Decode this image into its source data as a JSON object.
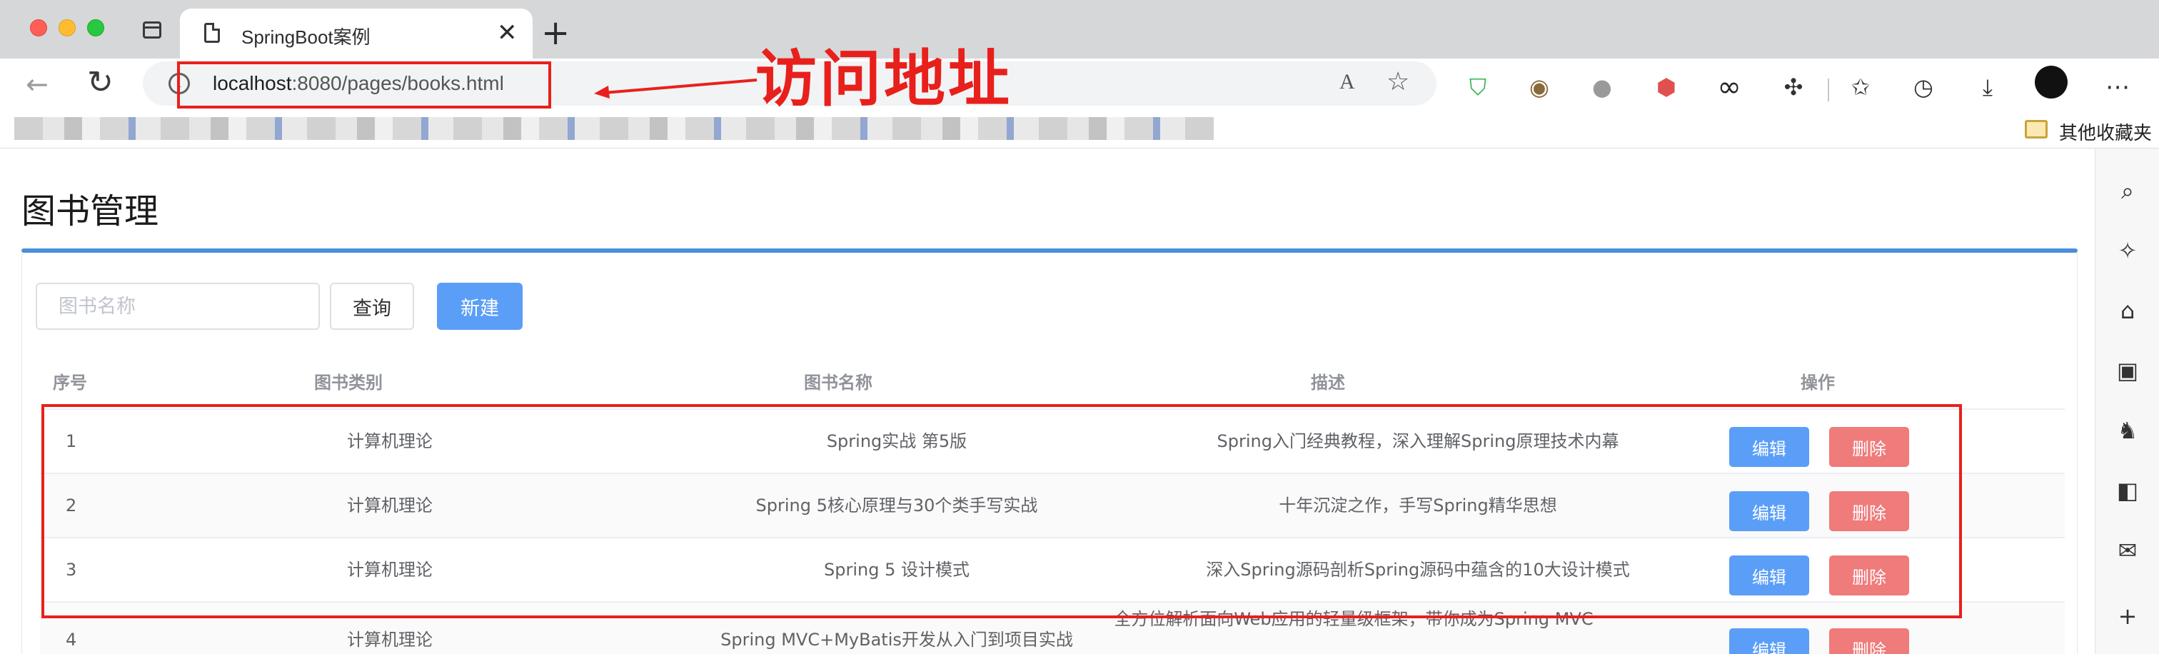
{
  "browser": {
    "tab_title": "SpringBoot案例",
    "tab_close": "✕",
    "new_tab": "+",
    "url_host": "localhost",
    "url_rest": ":8080/pages/books.html",
    "read_aloud": "A",
    "bookmarks_other": "其他收藏夹"
  },
  "annotation": {
    "label": "访问地址",
    "color": "#e8201c"
  },
  "page": {
    "title": "图书管理",
    "search_placeholder": "图书名称",
    "query_label": "查询",
    "new_label": "新建",
    "columns": [
      "序号",
      "图书类别",
      "图书名称",
      "描述",
      "操作"
    ],
    "rows": [
      {
        "no": "1",
        "type": "计算机理论",
        "name": "Spring实战 第5版",
        "desc": "Spring入门经典教程，深入理解Spring原理技术内幕"
      },
      {
        "no": "2",
        "type": "计算机理论",
        "name": "Spring 5核心原理与30个类手写实战",
        "desc": "十年沉淀之作，手写Spring精华思想"
      },
      {
        "no": "3",
        "type": "计算机理论",
        "name": "Spring 5 设计模式",
        "desc": "深入Spring源码剖析Spring源码中蕴含的10大设计模式"
      },
      {
        "no": "4",
        "type": "计算机理论",
        "name": "Spring MVC+MyBatis开发从入门到项目实战",
        "desc": "全方位解析面向Web应用的轻量级框架，带你成为Spring MVC"
      }
    ],
    "edit_label": "编辑",
    "delete_label": "删除"
  },
  "colors": {
    "primary": "#5a9ef7",
    "danger": "#ef7b7b",
    "accent_rule": "#4a90d9"
  }
}
